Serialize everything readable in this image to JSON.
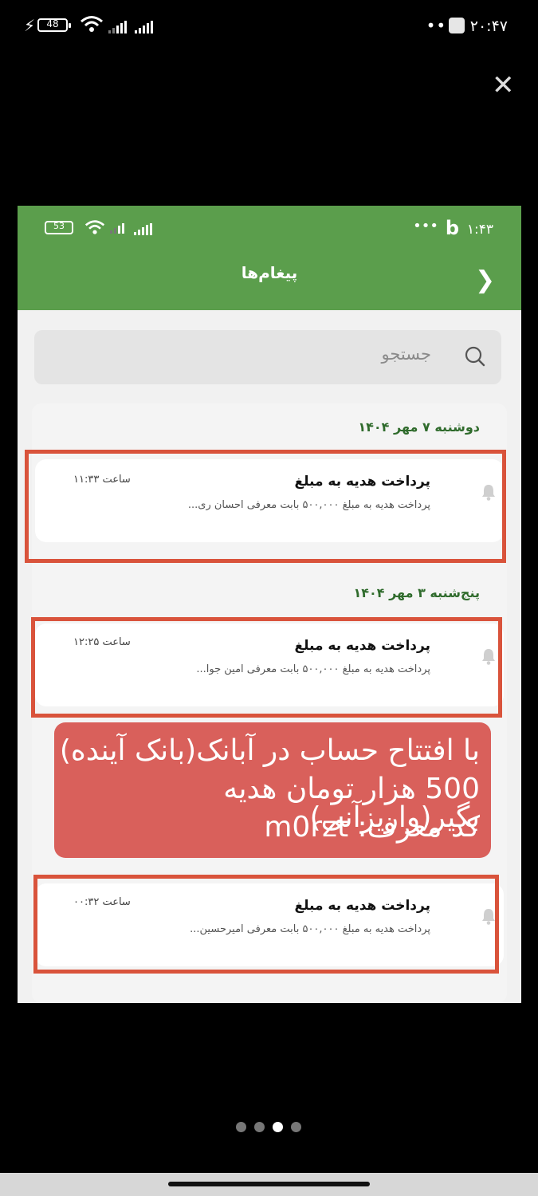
{
  "outer_status": {
    "time": "۲۰:۴۷",
    "dots": "•••",
    "battery": "48"
  },
  "inner": {
    "status": {
      "time": "۱:۴۳",
      "dots": "•••",
      "app_letter": "b",
      "battery": "53"
    },
    "header_title": "پیغام‌ها",
    "search_placeholder": "جستجو",
    "groups": [
      {
        "date": "دوشنبه ۷ مهر ۱۴۰۴",
        "title": "پرداخت هدیه به مبلغ",
        "body": "پرداخت هدیه به مبلغ ۵۰۰,۰۰۰ بابت معرفی احسان ری...",
        "time": "ساعت ۱۱:۳۳"
      },
      {
        "date": "پنج‌شنبه ۳ مهر ۱۴۰۴",
        "title": "پرداخت هدیه به مبلغ",
        "body": "پرداخت هدیه به مبلغ ۵۰۰,۰۰۰ بابت معرفی امین جوا...",
        "time": "ساعت ۱۲:۲۵"
      },
      {
        "title": "پرداخت هدیه به مبلغ",
        "body": "پرداخت هدیه به مبلغ ۵۰۰,۰۰۰ بابت معرفی امیرحسین...",
        "time": "ساعت ۰۰:۳۲"
      }
    ],
    "promo": {
      "line1": "با افتتاح حساب در آبانک(بانک آینده)",
      "line2": "500 هزار تومان هدیه بگیر(واریزآنی)",
      "line3": "کد معرف: m0rzt"
    }
  },
  "colors": {
    "header_green": "#5b9e4c",
    "highlight_red": "#d9533b",
    "promo_red": "#d9605b"
  },
  "pager": {
    "count": 4,
    "active_index": 2
  }
}
